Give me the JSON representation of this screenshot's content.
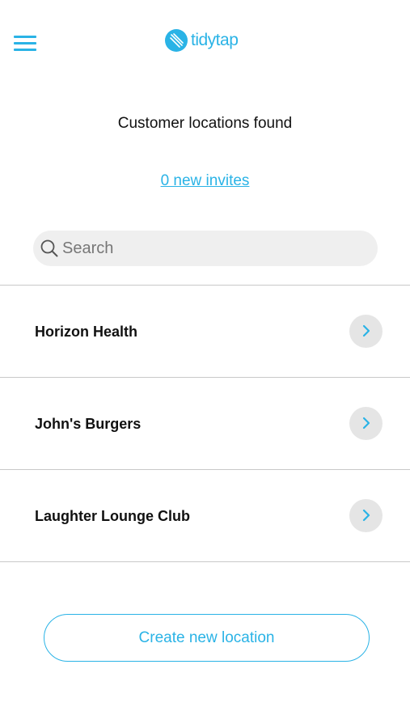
{
  "header": {
    "menu_icon": "hamburger-menu-icon",
    "logo_text": "tidytap",
    "accent_color": "#2ab3e6"
  },
  "main": {
    "title": "Customer locations found",
    "invites_link": "0 new invites",
    "search": {
      "placeholder": "Search",
      "value": ""
    }
  },
  "locations": [
    {
      "name": "Horizon Health"
    },
    {
      "name": "John's Burgers"
    },
    {
      "name": "Laughter Lounge Club"
    }
  ],
  "actions": {
    "create_label": "Create new location"
  }
}
